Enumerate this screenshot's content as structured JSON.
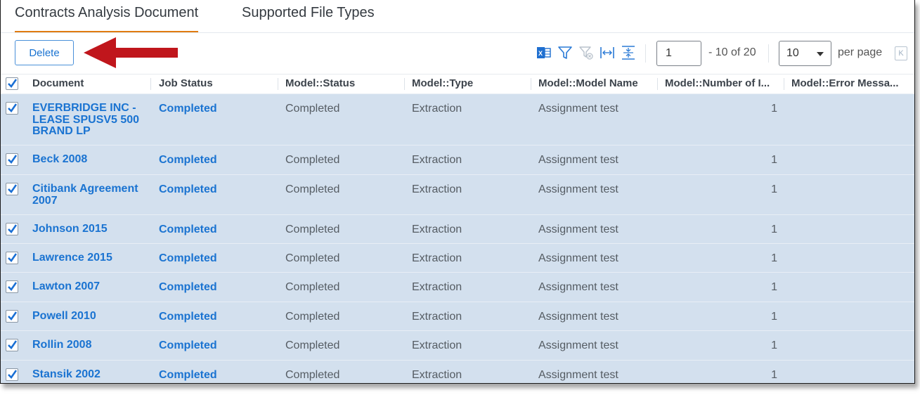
{
  "tabs": [
    {
      "label": "Contracts Analysis Document",
      "active": true
    },
    {
      "label": "Supported File Types",
      "active": false
    }
  ],
  "toolbar": {
    "delete_label": "Delete",
    "icons": [
      "excel-export-icon",
      "filter-icon",
      "clear-filter-icon",
      "fit-columns-icon",
      "collapse-rows-icon"
    ],
    "annotation": "red-arrow-pointing-to-delete"
  },
  "pagination": {
    "page_value": "1",
    "range_text": "- 10 of 20",
    "per_page_value": "10",
    "per_page_label": "per page",
    "first_page_label": "K"
  },
  "colors": {
    "accent_tab": "#e07b10",
    "link": "#1a73d1",
    "selected_row": "#d3e0ee",
    "arrow": "#c0161c"
  },
  "table": {
    "select_all": true,
    "columns": [
      "Document",
      "Job Status",
      "Model::Status",
      "Model::Type",
      "Model::Model Name",
      "Model::Number of I...",
      "Model::Error Messa..."
    ],
    "rows": [
      {
        "checked": true,
        "document": "EVERBRIDGE INC - LEASE SPUSV5 500 BRAND LP",
        "job_status": "Completed",
        "model_status": "Completed",
        "model_type": "Extraction",
        "model_name": "Assignment test",
        "number": "1",
        "error": ""
      },
      {
        "checked": true,
        "document": "Beck 2008",
        "job_status": "Completed",
        "model_status": "Completed",
        "model_type": "Extraction",
        "model_name": "Assignment test",
        "number": "1",
        "error": ""
      },
      {
        "checked": true,
        "document": "Citibank Agreement 2007",
        "job_status": "Completed",
        "model_status": "Completed",
        "model_type": "Extraction",
        "model_name": "Assignment test",
        "number": "1",
        "error": ""
      },
      {
        "checked": true,
        "document": "Johnson 2015",
        "job_status": "Completed",
        "model_status": "Completed",
        "model_type": "Extraction",
        "model_name": "Assignment test",
        "number": "1",
        "error": ""
      },
      {
        "checked": true,
        "document": "Lawrence 2015",
        "job_status": "Completed",
        "model_status": "Completed",
        "model_type": "Extraction",
        "model_name": "Assignment test",
        "number": "1",
        "error": ""
      },
      {
        "checked": true,
        "document": "Lawton 2007",
        "job_status": "Completed",
        "model_status": "Completed",
        "model_type": "Extraction",
        "model_name": "Assignment test",
        "number": "1",
        "error": ""
      },
      {
        "checked": true,
        "document": "Powell 2010",
        "job_status": "Completed",
        "model_status": "Completed",
        "model_type": "Extraction",
        "model_name": "Assignment test",
        "number": "1",
        "error": ""
      },
      {
        "checked": true,
        "document": "Rollin 2008",
        "job_status": "Completed",
        "model_status": "Completed",
        "model_type": "Extraction",
        "model_name": "Assignment test",
        "number": "1",
        "error": ""
      },
      {
        "checked": true,
        "document": "Stansik 2002",
        "job_status": "Completed",
        "model_status": "Completed",
        "model_type": "Extraction",
        "model_name": "Assignment test",
        "number": "1",
        "error": ""
      }
    ]
  }
}
